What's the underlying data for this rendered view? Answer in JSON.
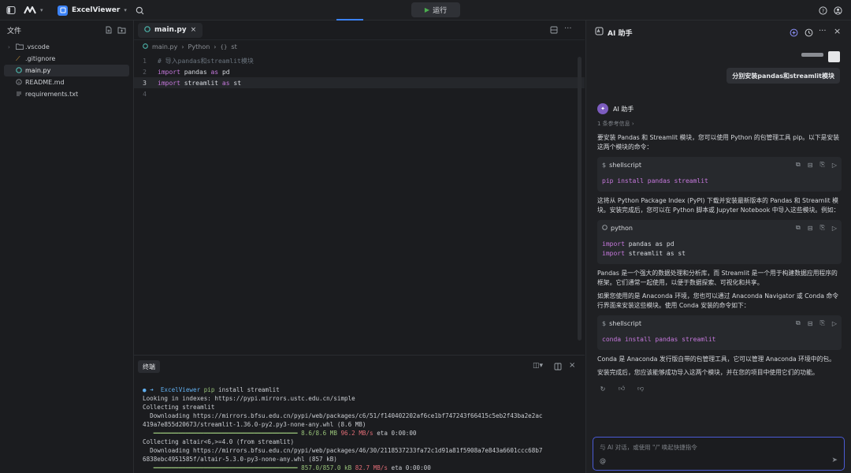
{
  "topbar": {
    "project_name": "ExcelViewer",
    "run_label": "运行"
  },
  "sidebar": {
    "title": "文件",
    "items": [
      {
        "label": ".vscode",
        "icon": "folder-icon",
        "color": "#8d9197"
      },
      {
        "label": ".gitignore",
        "icon": "git-icon",
        "color": "#e0a33d"
      },
      {
        "label": "main.py",
        "icon": "python-icon",
        "color": "#4db6ac"
      },
      {
        "label": "README.md",
        "icon": "info-icon",
        "color": "#8d9197"
      },
      {
        "label": "requirements.txt",
        "icon": "list-icon",
        "color": "#8d9197"
      }
    ]
  },
  "editor": {
    "tab_label": "main.py",
    "breadcrumb": [
      "main.py",
      "Python",
      "st"
    ],
    "lines": [
      {
        "num": "1",
        "comment": "# 导入pandas和streamlit模块"
      },
      {
        "num": "2",
        "kw": "import",
        "mod": "pandas",
        "as": "as",
        "alias": "pd"
      },
      {
        "num": "3",
        "kw": "import",
        "mod": "streamlit",
        "as": "as",
        "alias": "st"
      },
      {
        "num": "4"
      }
    ]
  },
  "terminal": {
    "tab_label": "终端",
    "prompt_project": "ExcelViewer",
    "command": "pip install streamlit",
    "lines": {
      "l2": "Looking in indexes: https://pypi.mirrors.ustc.edu.cn/simple",
      "l3": "Collecting streamlit",
      "l4": "  Downloading https://mirrors.bfsu.edu.cn/pypi/web/packages/c6/51/f140402202af6ce1bf747243f66415c5eb2f43ba2e2ac",
      "l5": "419a7e855d20673/streamlit-1.36.0-py2.py3-none-any.whl (8.6 MB)",
      "l6_size": "8.6/8.6 MB",
      "l6_speed": "96.2 MB/s",
      "l6_eta": "eta 0:00:00",
      "l7": "Collecting altair<6,>=4.0 (from streamlit)",
      "l8": "  Downloading https://mirrors.bfsu.edu.cn/pypi/web/packages/46/30/2118537233fa72c1d91a81f5908a7e843a6601ccc68b7",
      "l9": "6838ebc4951585f/altair-5.3.0-py3-none-any.whl (857 kB)",
      "l10_size": "857.0/857.0 kB",
      "l10_speed": "82.7 MB/s",
      "l10_eta": "eta 0:00:00"
    }
  },
  "ai": {
    "title": "AI 助手",
    "user_message": "分别安装pandas和streamlit模块",
    "assistant_name": "AI 助手",
    "ref_info": "1 条参考信息 ›",
    "p1": "要安装 Pandas 和 Streamlit 模块，您可以使用 Python 的包管理工具 pip。以下是安装这两个模块的命令：",
    "block1_lang": "shellscript",
    "block1_code": "pip install pandas streamlit",
    "p2": "这将从 Python Package Index (PyPI) 下载并安装最新版本的 Pandas 和 Streamlit 模块。安装完成后，您可以在 Python 脚本或 Jupyter Notebook 中导入这些模块。例如：",
    "block2_lang": "python",
    "block2_line1_kw": "import",
    "block2_line1_rest": "pandas as pd",
    "block2_line2_kw": "import",
    "block2_line2_rest": "streamlit as st",
    "p3": "Pandas 是一个强大的数据处理和分析库，而 Streamlit 是一个用于构建数据应用程序的框架。它们通常一起使用，以便于数据探索、可视化和共享。",
    "p4": "如果您使用的是 Anaconda 环境，您也可以通过 Anaconda Navigator 或 Conda 命令行界面来安装这些模块。使用 Conda 安装的命令如下：",
    "block3_lang": "shellscript",
    "block3_code": "conda install pandas streamlit",
    "p5": "Conda 是 Anaconda 发行版自带的包管理工具，它可以管理 Anaconda 环境中的包。",
    "p6": "安装完成后，您应该能够成功导入这两个模块，并在您的项目中使用它们的功能。",
    "input_placeholder": "与 AI 对话，或使用 \"/\" 唤起快捷指令"
  },
  "colors": {
    "accent": "#3b82f6",
    "input_border": "#4b5bd6",
    "keyword": "#c678dd",
    "progress": "#98c379"
  }
}
